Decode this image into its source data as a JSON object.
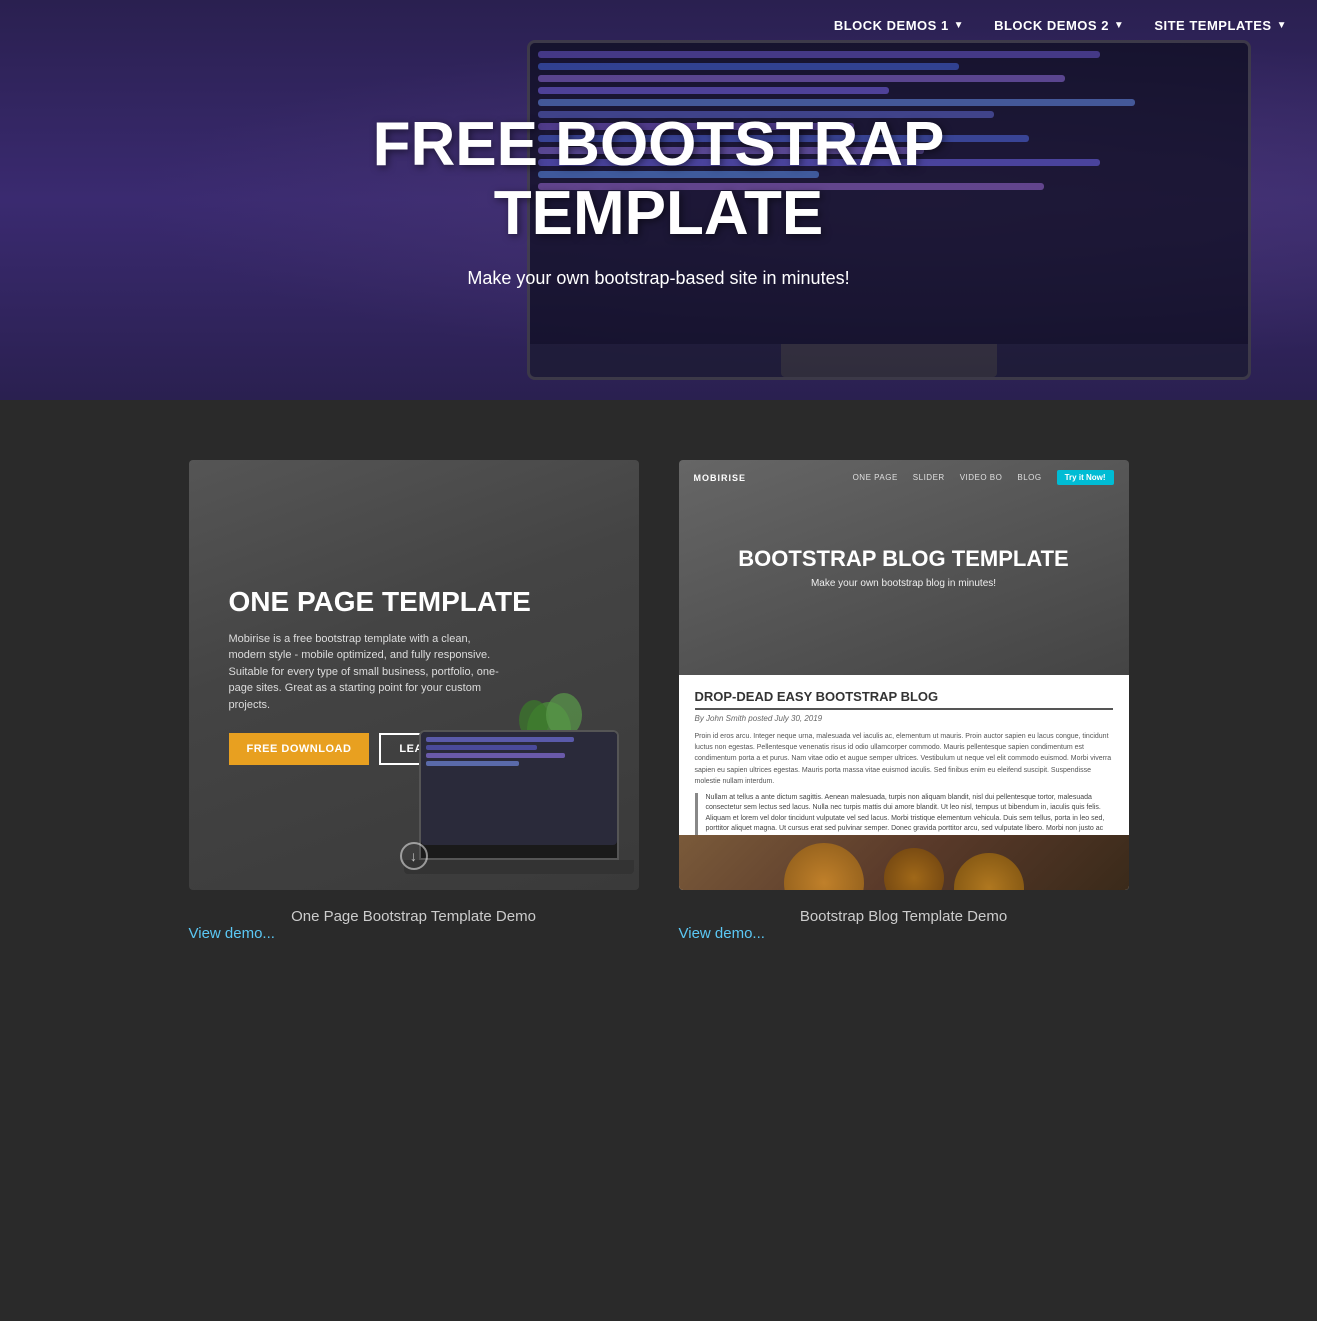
{
  "nav": {
    "items": [
      {
        "label": "BLOCK DEMOS 1",
        "hasDropdown": true
      },
      {
        "label": "BLOCK DEMOS 2",
        "hasDropdown": true
      },
      {
        "label": "SITE TEMPLATES",
        "hasDropdown": true
      }
    ]
  },
  "hero": {
    "title": "FREE BOOTSTRAP TEMPLATE",
    "subtitle": "Make your own bootstrap-based site in minutes!"
  },
  "cards": [
    {
      "id": "one-page",
      "title": "ONE PAGE TEMPLATE",
      "description": "Mobirise is a free bootstrap template with a clean, modern style - mobile optimized, and fully responsive. Suitable for every type of small business, portfolio, one-page sites. Great as a starting point for your custom projects.",
      "btn1": "FREE DOWNLOAD",
      "btn2": "LEARN MORE",
      "label": "One Page Bootstrap Template Demo",
      "link": "View demo..."
    },
    {
      "id": "blog",
      "brand": "MOBIRISE",
      "nav_items": [
        "ONE PAGE",
        "SLIDER",
        "VIDEO BO",
        "BLOG"
      ],
      "try_btn": "Try it Now!",
      "title": "BOOTSTRAP BLOG TEMPLATE",
      "subtitle": "Make your own bootstrap blog in minutes!",
      "blog_title": "DROP-DEAD EASY BOOTSTRAP BLOG",
      "byline": "By John Smith posted July 30, 2019",
      "body1": "Proin id eros arcu. Integer neque urna, malesuada vel iaculis ac, elementum ut mauris. Proin auctor sapien eu lacus congue, tincidunt luctus non egestas. Pellentesque venenatis risus id odio ullamcorper commodo. Mauris pellentesque sapien condimentum est condimentum porta a et purus. Nam vitae odio et augue semper ultrices. Vestibulum ut neque vel elit commodo euismod. Morbi viverra sapien eu sapien ultrices egestas. Mauris porta massa vitae euismod iaculis. Sed finibus enim eu eleifend suscipit. Suspendisse molestie nullam interdum.",
      "body2": "Nullam at tellus a ante dictum sagittis. Aenean malesuada, turpis non aliquam blandit, nisl dui pellentesque tortor, malesuada consectetur sem lectus sed lacus. Nulla nec turpis mattis dui amore blandit. Ut leo nisl, tempus ut bibendum in, iaculis quis felis. Aliquam et lorem vel dolor tincidunt vulputate vel sed lacus. Morbi tristique elementum vehicula. Duis sem tellus, porta in leo sed, porttitor aliquet magna. Ut cursus erat sed pulvinar semper. Donec gravida porttitor arcu, sed vulputate libero. Morbi non justo ac tellus tempus ornare. Nam tortor augue, commodo aget lobortis non, consectetur aget arcu. In hac habitasse platea dictumst. Nam congue odio neque, in tempus sapien faucibus non.",
      "label": "Bootstrap Blog Template Demo",
      "link": "View demo..."
    }
  ]
}
